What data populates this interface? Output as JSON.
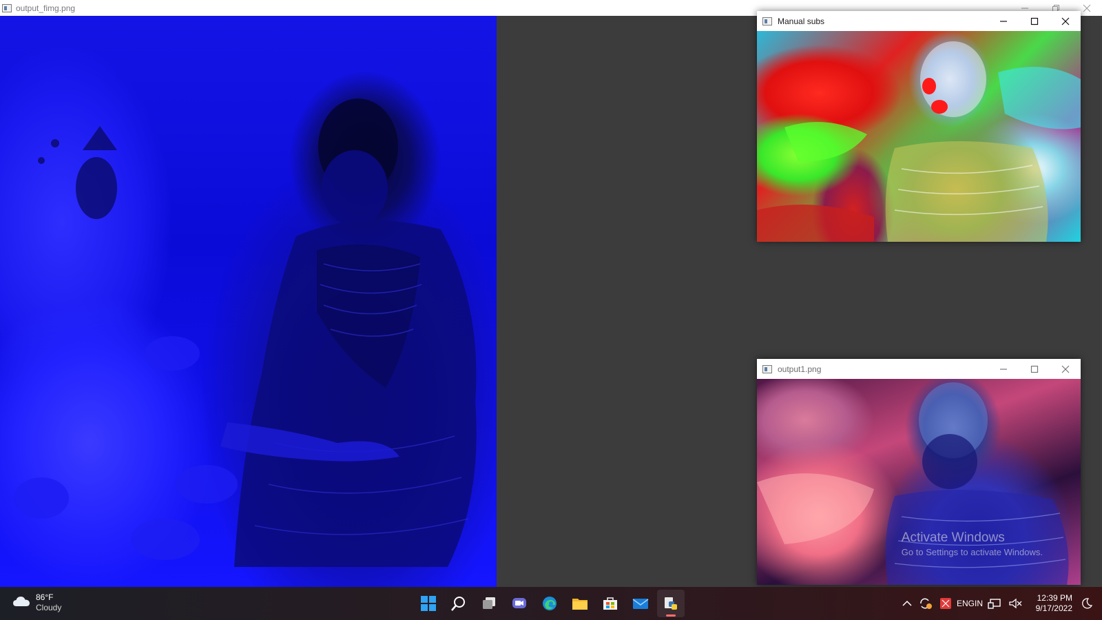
{
  "main_window": {
    "title": "output_fimg.png",
    "image_icon": "opencv-window-icon"
  },
  "windows": [
    {
      "id": "manual",
      "title": "Manual subs",
      "controls": [
        "minimize",
        "maximize",
        "close"
      ]
    },
    {
      "id": "output1",
      "title": "output1.png",
      "controls": [
        "minimize",
        "maximize",
        "close"
      ],
      "watermark_line1": "Activate Windows",
      "watermark_line2": "Go to Settings to activate Windows."
    }
  ],
  "taskbar": {
    "weather": {
      "temp": "86°F",
      "condition": "Cloudy",
      "icon": "cloud-icon"
    },
    "apps": [
      {
        "name": "start",
        "icon": "windows-logo-icon"
      },
      {
        "name": "search",
        "icon": "search-icon"
      },
      {
        "name": "task-view",
        "icon": "task-view-icon"
      },
      {
        "name": "teams-chat",
        "icon": "chat-icon"
      },
      {
        "name": "edge",
        "icon": "edge-icon"
      },
      {
        "name": "file-explorer",
        "icon": "folder-icon"
      },
      {
        "name": "store",
        "icon": "store-icon"
      },
      {
        "name": "mail",
        "icon": "mail-icon"
      },
      {
        "name": "python",
        "icon": "python-icon",
        "active": true
      }
    ],
    "tray": {
      "lang_top": "ENG",
      "lang_bottom": "IN",
      "time": "12:39 PM",
      "date": "9/17/2022"
    }
  },
  "colors": {
    "desktop": "#3c3c3c",
    "blue_image": "#1010e0",
    "taskbar_active_indicator": "#ff6f6f"
  }
}
